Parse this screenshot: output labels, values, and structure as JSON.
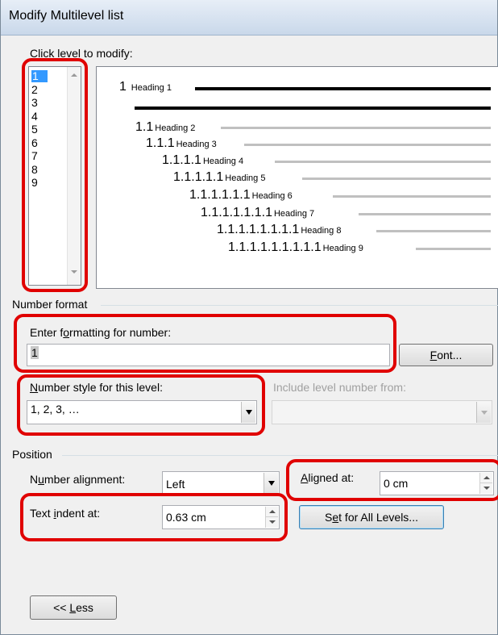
{
  "window": {
    "title": "Modify Multilevel list"
  },
  "levels": {
    "label_pre": "Click le",
    "label_acc": "v",
    "label_post": "el to modify:",
    "items": [
      "1",
      "2",
      "3",
      "4",
      "5",
      "6",
      "7",
      "8",
      "9"
    ],
    "selected": "1"
  },
  "preview": {
    "rows": [
      {
        "number": "1",
        "heading": "Heading 1"
      },
      {
        "number": "1.1",
        "heading": "Heading 2"
      },
      {
        "number": "1.1.1",
        "heading": "Heading 3"
      },
      {
        "number": "1.1.1.1",
        "heading": "Heading 4"
      },
      {
        "number": "1.1.1.1.1",
        "heading": "Heading 5"
      },
      {
        "number": "1.1.1.1.1.1",
        "heading": "Heading 6"
      },
      {
        "number": "1.1.1.1.1.1.1",
        "heading": "Heading 7"
      },
      {
        "number": "1.1.1.1.1.1.1.1",
        "heading": "Heading 8"
      },
      {
        "number": "1.1.1.1.1.1.1.1.1",
        "heading": "Heading 9"
      }
    ]
  },
  "number_format": {
    "section_label": "Number format",
    "enter_label_pre": "Enter f",
    "enter_label_acc": "o",
    "enter_label_post": "rmatting for number:",
    "value": "1",
    "font_button_acc": "F",
    "font_button_post": "ont...",
    "style_label_acc": "N",
    "style_label_post": "umber style for this level:",
    "style_value": "1, 2, 3, …",
    "include_label": "Include level number from:",
    "include_value": ""
  },
  "position": {
    "section_label": "Position",
    "alignment_label_pre": "N",
    "alignment_label_acc": "u",
    "alignment_label_post": "mber alignment:",
    "alignment_value": "Left",
    "aligned_at_label_acc": "A",
    "aligned_at_label_post": "ligned at:",
    "aligned_at_value": "0 cm",
    "indent_label_pre": "Text ",
    "indent_label_acc": "i",
    "indent_label_post": "ndent at:",
    "indent_value": "0.63 cm",
    "set_all_pre": "S",
    "set_all_acc": "e",
    "set_all_post": "t for All Levels..."
  },
  "footer": {
    "less_pre": "<< ",
    "less_acc": "L",
    "less_post": "ess"
  },
  "colors": {
    "highlight": "#e00000",
    "selection": "#3399ff"
  }
}
